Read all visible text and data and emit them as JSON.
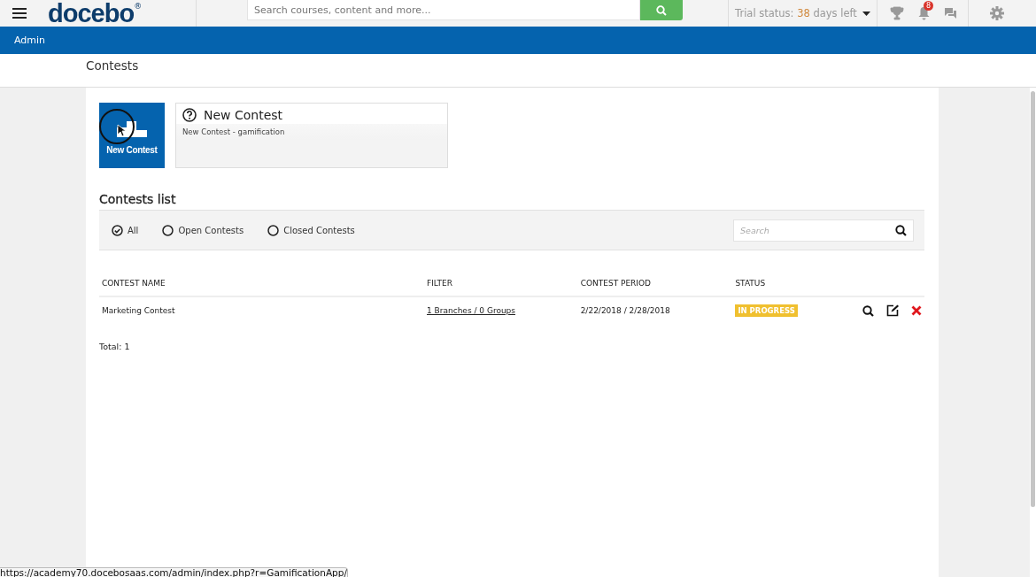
{
  "header": {
    "logo": "docebo",
    "logo_mark": "®",
    "search": {
      "placeholder": "Search courses, content and more..."
    },
    "trial": {
      "label": "Trial status:",
      "days": "38",
      "suffix": "days left"
    },
    "notifications": {
      "count": "8"
    }
  },
  "admin_bar": {
    "label": "Admin"
  },
  "page": {
    "title": "Contests"
  },
  "new_contest": {
    "tile_label": "New Contest",
    "card_title": "New Contest",
    "card_description": "New Contest - gamification"
  },
  "contests_list": {
    "title": "Contests list",
    "filters": [
      {
        "label": "All",
        "selected": true
      },
      {
        "label": "Open Contests",
        "selected": false
      },
      {
        "label": "Closed Contests",
        "selected": false
      }
    ],
    "search": {
      "placeholder": "Search"
    },
    "table": {
      "columns": [
        "CONTEST NAME",
        "FILTER",
        "CONTEST PERIOD",
        "STATUS"
      ],
      "rows": [
        {
          "name": "Marketing Contest",
          "filter": "1 Branches / 0 Groups",
          "period": "2/22/2018 / 2/28/2018",
          "status": "IN PROGRESS"
        }
      ]
    },
    "total": "Total: 1"
  },
  "status_bar": {
    "url": "https://academy70.docebosaas.com/admin/index.php?r=GamificationApp/"
  }
}
